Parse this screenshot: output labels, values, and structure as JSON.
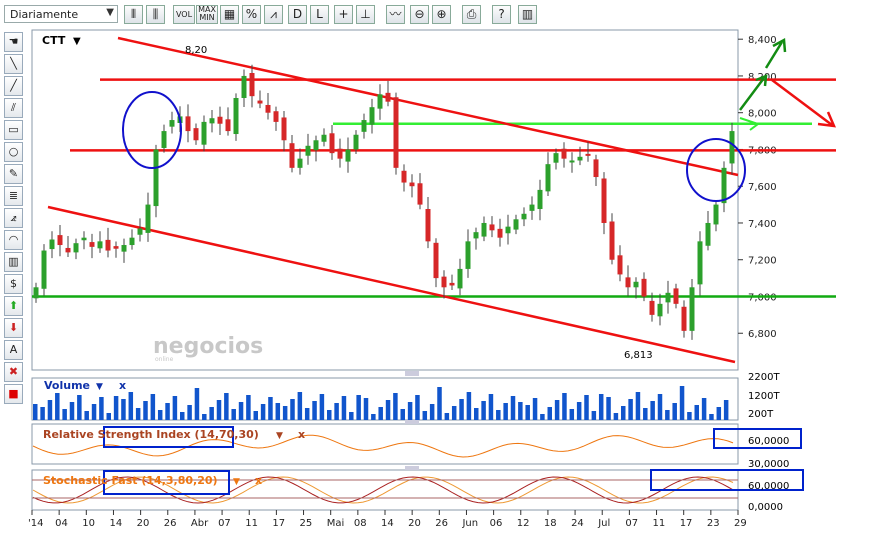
{
  "toolbar": {
    "period": "Diariamente",
    "buttons": [
      {
        "name": "bar-chart-icon",
        "label": ""
      },
      {
        "name": "candlestick-icon",
        "label": ""
      },
      {
        "name": "volume-button",
        "label": "VOL"
      },
      {
        "name": "maxmin-button",
        "label": "MAX\nMIN"
      },
      {
        "name": "grid-icon",
        "label": ""
      },
      {
        "name": "percent-button",
        "label": "%"
      },
      {
        "name": "trend-chart-icon",
        "label": ""
      },
      {
        "name": "daily-button",
        "label": "D"
      },
      {
        "name": "log-button",
        "label": "L"
      },
      {
        "name": "crosshair-icon",
        "label": "+"
      },
      {
        "name": "crosshair-value-icon",
        "label": ""
      },
      {
        "name": "compare-icon",
        "label": ""
      },
      {
        "name": "zoom-out-icon",
        "label": ""
      },
      {
        "name": "zoom-in-icon",
        "label": ""
      },
      {
        "name": "print-icon",
        "label": ""
      },
      {
        "name": "help-button",
        "label": "?"
      },
      {
        "name": "book-icon",
        "label": ""
      }
    ]
  },
  "left_tools": [
    "hand-icon",
    "line-icon",
    "diagonal-line-icon",
    "parallel-lines-icon",
    "rectangle-icon",
    "circle-icon",
    "pencil-icon",
    "fibonacci-icon",
    "fibonacci-fan-icon",
    "arc-icon",
    "channel-icon",
    "dollar-icon",
    "arrow-up-icon",
    "arrow-down-icon",
    "text-icon",
    "delete-icon",
    "color-icon"
  ],
  "left_tool_text": {
    "text": "A"
  },
  "chart": {
    "symbol": "CTT",
    "watermark": "negocios",
    "watermark_sub": "online",
    "high_label": "8,20",
    "low_label": "6,813",
    "price_ticks": [
      "8,400",
      "8,200",
      "8,000",
      "7,800",
      "7,600",
      "7,400",
      "7,200",
      "7,000",
      "6,800"
    ],
    "date_ticks": [
      "'14",
      "04",
      "10",
      "14",
      "20",
      "26",
      "Abr",
      "07",
      "11",
      "17",
      "25",
      "Mai",
      "08",
      "14",
      "20",
      "26",
      "Jun",
      "06",
      "12",
      "18",
      "24",
      "Jul",
      "07",
      "11",
      "17",
      "23",
      "29"
    ]
  },
  "volume_panel": {
    "title": "Volume",
    "close": "x",
    "ticks": [
      "2200T",
      "1200T",
      "200T"
    ]
  },
  "rsi_panel": {
    "title": "Relative Strength Index (14,70,30)",
    "close": "x",
    "ticks": [
      "60,0000",
      "30,0000"
    ]
  },
  "stoch_panel": {
    "title": "Stochastic Fast (14,3,80,20)",
    "close": "x",
    "ticks": [
      "60,0000",
      "0,0000"
    ]
  },
  "colors": {
    "up": "#2ca02c",
    "down": "#d62728",
    "trend": "#ee1111",
    "support": "#11aa11",
    "target": "#33ee33",
    "circle": "#1111cc",
    "volume": "#1155cc",
    "osc": "#ee7711",
    "annot": "#0022cc"
  },
  "chart_data": {
    "type": "candlestick",
    "y_range": [
      6600,
      8450
    ],
    "sessions": 88,
    "closes": [
      7050,
      7250,
      7310,
      7280,
      7240,
      7290,
      7320,
      7270,
      7300,
      7250,
      7260,
      7280,
      7320,
      7370,
      7500,
      7800,
      7900,
      7960,
      7980,
      7900,
      7850,
      7950,
      7970,
      7940,
      7900,
      8080,
      8200,
      8090,
      8050,
      8000,
      7950,
      7850,
      7700,
      7750,
      7820,
      7850,
      7880,
      7780,
      7750,
      7800,
      7880,
      7960,
      8030,
      8100,
      8060,
      7700,
      7620,
      7600,
      7500,
      7300,
      7100,
      7050,
      7060,
      7150,
      7300,
      7350,
      7400,
      7360,
      7320,
      7380,
      7420,
      7450,
      7500,
      7580,
      7720,
      7780,
      7750,
      7740,
      7760,
      7770,
      7650,
      7400,
      7200,
      7120,
      7050,
      7080,
      7000,
      6900,
      6960,
      7020,
      6960,
      6813,
      7050,
      7300,
      7400,
      7500,
      7700,
      7900
    ],
    "horizontal_levels": [
      8180,
      7795,
      7000
    ],
    "target_level": 7940,
    "annotations": {
      "high": "8,20",
      "low": "6,813"
    }
  }
}
